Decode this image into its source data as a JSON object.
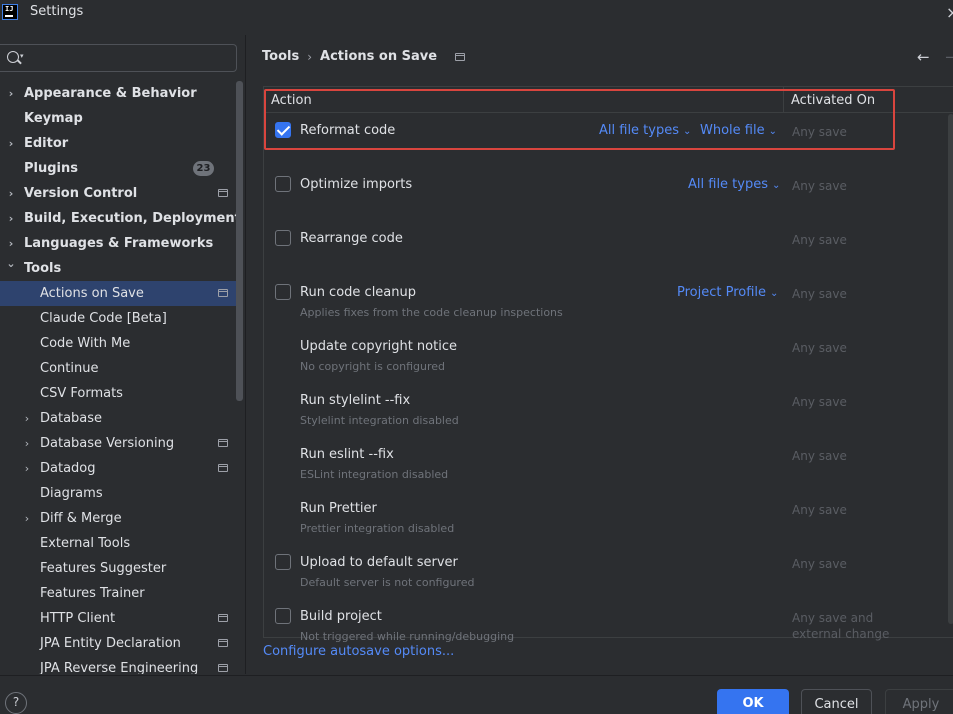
{
  "window": {
    "title": "Settings",
    "logo_text": "IJ"
  },
  "search": {
    "placeholder": ""
  },
  "sidebar": {
    "items": [
      {
        "label": "Appearance & Behavior",
        "level": 0,
        "bold": true,
        "expandable": true,
        "expanded": false
      },
      {
        "label": "Keymap",
        "level": 0,
        "bold": true,
        "expandable": false
      },
      {
        "label": "Editor",
        "level": 0,
        "bold": true,
        "expandable": true,
        "expanded": false
      },
      {
        "label": "Plugins",
        "level": 0,
        "bold": true,
        "expandable": false,
        "badge": "23"
      },
      {
        "label": "Version Control",
        "level": 0,
        "bold": true,
        "expandable": true,
        "expanded": false,
        "project_icon": true
      },
      {
        "label": "Build, Execution, Deployment",
        "level": 0,
        "bold": true,
        "expandable": true,
        "expanded": false
      },
      {
        "label": "Languages & Frameworks",
        "level": 0,
        "bold": true,
        "expandable": true,
        "expanded": false
      },
      {
        "label": "Tools",
        "level": 0,
        "bold": true,
        "expandable": true,
        "expanded": true
      },
      {
        "label": "Actions on Save",
        "level": 1,
        "selected": true,
        "project_icon": true
      },
      {
        "label": "Claude Code [Beta]",
        "level": 1
      },
      {
        "label": "Code With Me",
        "level": 1
      },
      {
        "label": "Continue",
        "level": 1
      },
      {
        "label": "CSV Formats",
        "level": 1
      },
      {
        "label": "Database",
        "level": 1,
        "expandable": true,
        "expanded": false
      },
      {
        "label": "Database Versioning",
        "level": 1,
        "expandable": true,
        "expanded": false,
        "project_icon": true
      },
      {
        "label": "Datadog",
        "level": 1,
        "expandable": true,
        "expanded": false,
        "project_icon": true
      },
      {
        "label": "Diagrams",
        "level": 1
      },
      {
        "label": "Diff & Merge",
        "level": 1,
        "expandable": true,
        "expanded": false
      },
      {
        "label": "External Tools",
        "level": 1
      },
      {
        "label": "Features Suggester",
        "level": 1
      },
      {
        "label": "Features Trainer",
        "level": 1
      },
      {
        "label": "HTTP Client",
        "level": 1,
        "project_icon": true
      },
      {
        "label": "JPA Entity Declaration",
        "level": 1,
        "project_icon": true
      },
      {
        "label": "JPA Reverse Engineering",
        "level": 1,
        "project_icon": true
      }
    ]
  },
  "breadcrumb": {
    "parent": "Tools",
    "separator": "›",
    "current": "Actions on Save"
  },
  "table": {
    "headers": {
      "action": "Action",
      "activated_on": "Activated On"
    },
    "rows": [
      {
        "title": "Reformat code",
        "subtitle": "",
        "checkbox": true,
        "checked": true,
        "dropdowns": [
          "All file types",
          "Whole file"
        ],
        "activated_on": "Any save"
      },
      {
        "title": "Optimize imports",
        "subtitle": "",
        "checkbox": true,
        "checked": false,
        "dropdowns": [
          "All file types"
        ],
        "activated_on": "Any save"
      },
      {
        "title": "Rearrange code",
        "subtitle": "",
        "checkbox": true,
        "checked": false,
        "dropdowns": [],
        "activated_on": "Any save"
      },
      {
        "title": "Run code cleanup",
        "subtitle": "Applies fixes from the code cleanup inspections",
        "checkbox": true,
        "checked": false,
        "dropdowns": [
          "Project Profile"
        ],
        "activated_on": "Any save"
      },
      {
        "title": "Update copyright notice",
        "subtitle": "No copyright is configured",
        "checkbox": false,
        "checked": false,
        "dropdowns": [],
        "activated_on": "Any save"
      },
      {
        "title": "Run stylelint --fix",
        "subtitle": "Stylelint integration disabled",
        "checkbox": false,
        "checked": false,
        "dropdowns": [],
        "activated_on": "Any save"
      },
      {
        "title": "Run eslint --fix",
        "subtitle": "ESLint integration disabled",
        "checkbox": false,
        "checked": false,
        "dropdowns": [],
        "activated_on": "Any save"
      },
      {
        "title": "Run Prettier",
        "subtitle": "Prettier integration disabled",
        "checkbox": false,
        "checked": false,
        "dropdowns": [],
        "activated_on": "Any save"
      },
      {
        "title": "Upload to default server",
        "subtitle": "Default server is not configured",
        "checkbox": true,
        "checked": false,
        "dropdowns": [],
        "activated_on": "Any save"
      },
      {
        "title": "Build project",
        "subtitle": "Not triggered while running/debugging",
        "checkbox": true,
        "checked": false,
        "dropdowns": [],
        "activated_on": "Any save and external change"
      }
    ]
  },
  "links": {
    "autosave": "Configure autosave options..."
  },
  "footer": {
    "help": "?",
    "ok": "OK",
    "cancel": "Cancel",
    "apply": "Apply"
  },
  "icons": {
    "chevron_right": "›",
    "chevron_down": "⌄",
    "back_arrow": "←",
    "forward_arrow": "→",
    "close": "×"
  },
  "colors": {
    "background": "#2b2d30",
    "accent": "#3574f0",
    "link": "#548af7",
    "selection": "#2e436e",
    "highlight_box": "#d9453e"
  }
}
